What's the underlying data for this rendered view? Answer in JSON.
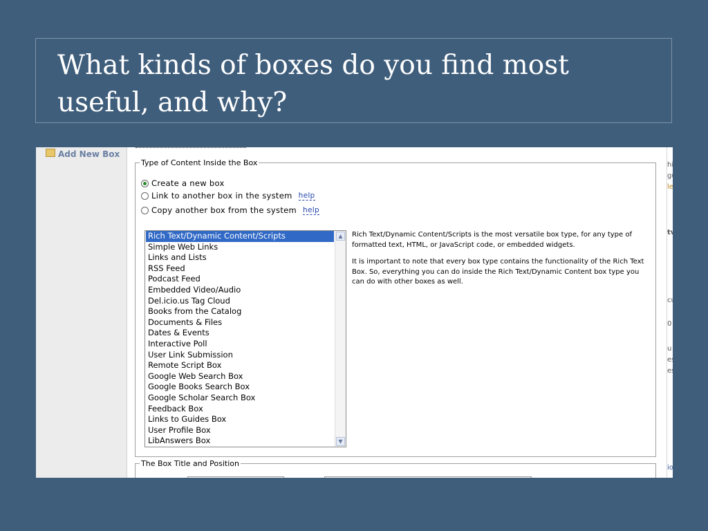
{
  "slide": {
    "title": "What kinds of boxes do you find most useful, and why?"
  },
  "sidebar": {
    "add_new_box": "Add New Box",
    "icon": "box-icon"
  },
  "content_type": {
    "legend": "Type of Content Inside the Box",
    "options": [
      {
        "label": "Create a new box",
        "selected": true,
        "help": ""
      },
      {
        "label": "Link to another box in the system",
        "selected": false,
        "help": "help"
      },
      {
        "label": "Copy another box from the system",
        "selected": false,
        "help": "help"
      }
    ],
    "box_types": [
      "Rich Text/Dynamic Content/Scripts",
      "Simple Web Links",
      "Links and Lists",
      "RSS Feed",
      "Podcast Feed",
      "Embedded Video/Audio",
      "Del.icio.us Tag Cloud",
      "Books from the Catalog",
      "Documents & Files",
      "Dates & Events",
      "Interactive Poll",
      "User Link Submission",
      "Remote Script Box",
      "Google Web Search Box",
      "Google Books Search Box",
      "Google Scholar Search Box",
      "Feedback Box",
      "Links to Guides Box",
      "User Profile Box",
      "LibAnswers Box"
    ],
    "selected_index": 0,
    "description": [
      "Rich Text/Dynamic Content/Scripts is the most versatile box type, for any type of formatted text, HTML, or JavaScript code, or embedded widgets.",
      "It is important to note that every box type contains the functionality of the Rich Text Box. So, everything you can do inside the Rich Text/Dynamic Content box type you can do with other boxes as well."
    ]
  },
  "title_position": {
    "legend": "The Box Title and Position"
  },
  "right_fragments": [
    "hi",
    "gu",
    "le",
    "tv",
    "cu",
    "0",
    "u",
    "es",
    "es",
    "io"
  ]
}
